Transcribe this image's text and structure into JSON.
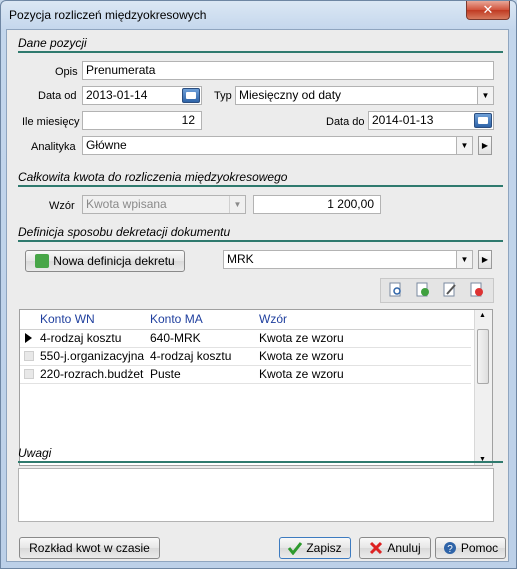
{
  "window": {
    "title": "Pozycja rozliczeń międzyokresowych",
    "close_label": "✕"
  },
  "sections": {
    "dane_pozycji": "Dane pozycji",
    "kwota": "Całkowita kwota do rozliczenia międzyokresowego",
    "definicja": "Definicja sposobu dekretacji dokumentu",
    "uwagi": "Uwagi"
  },
  "form": {
    "opis_label": "Opis",
    "opis_value": "Prenumerata",
    "data_od_label": "Data od",
    "data_od_value": "2013-01-14",
    "typ_label": "Typ",
    "typ_value": "Miesięczny od daty",
    "ile_miesiecy_label": "Ile miesięcy",
    "ile_miesiecy_value": "12",
    "data_do_label": "Data do",
    "data_do_value": "2014-01-13",
    "analityka_label": "Analityka",
    "analityka_value": "Główne",
    "wzor_label": "Wzór",
    "wzor_value": "Kwota wpisana",
    "kwota_value": "1 200,00",
    "nowa_definicja_label": "Nowa definicja dekretu",
    "definicja_value": "MRK",
    "uwagi_value": ""
  },
  "grid": {
    "columns": [
      "Konto WN",
      "Konto MA",
      "Wzór"
    ],
    "rows": [
      [
        "4-rodzaj kosztu",
        "640-MRK",
        "Kwota ze wzoru"
      ],
      [
        "550-j.organizacyjna",
        "4-rodzaj kosztu",
        "Kwota ze wzoru"
      ],
      [
        "220-rozrach.budżet",
        "Puste",
        "Kwota ze wzoru"
      ]
    ]
  },
  "buttons": {
    "rozklad": "Rozkład kwot w czasie",
    "zapisz": "Zapisz",
    "anuluj": "Anuluj",
    "pomoc": "Pomoc"
  },
  "colors": {
    "section_line": "#2f7a6e",
    "grid_header_text": "#1f3f9e",
    "titlebar": "#c4d6ea",
    "close_button": "#c8452d"
  }
}
